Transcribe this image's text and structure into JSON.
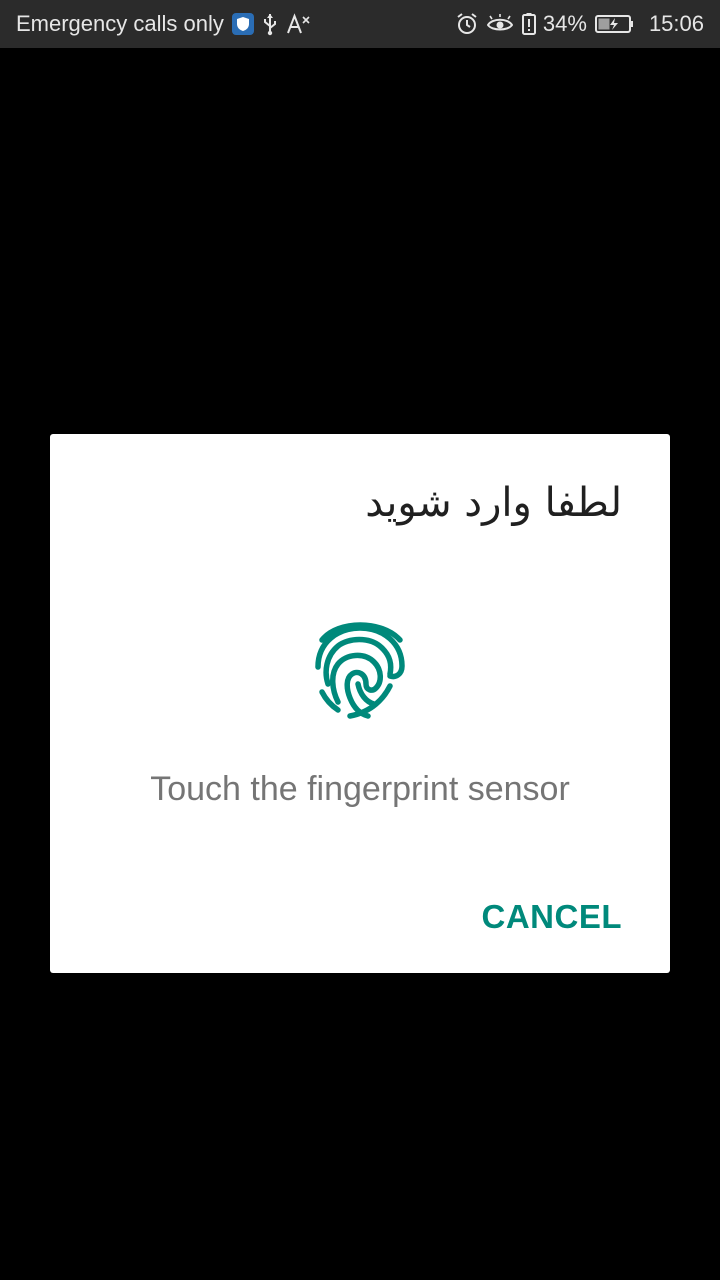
{
  "status_bar": {
    "carrier_text": "Emergency calls only",
    "battery_percent": "34%",
    "time": "15:06",
    "icons_left": [
      "shield-icon",
      "usb-icon",
      "font-size-icon"
    ],
    "icons_right": [
      "alarm-icon",
      "eye-icon",
      "battery-alert-icon",
      "battery-charging-icon"
    ]
  },
  "dialog": {
    "title": "لطفا وارد شوید",
    "message": "Touch the fingerprint sensor",
    "cancel_label": "CANCEL",
    "accent_color": "#00897b"
  }
}
